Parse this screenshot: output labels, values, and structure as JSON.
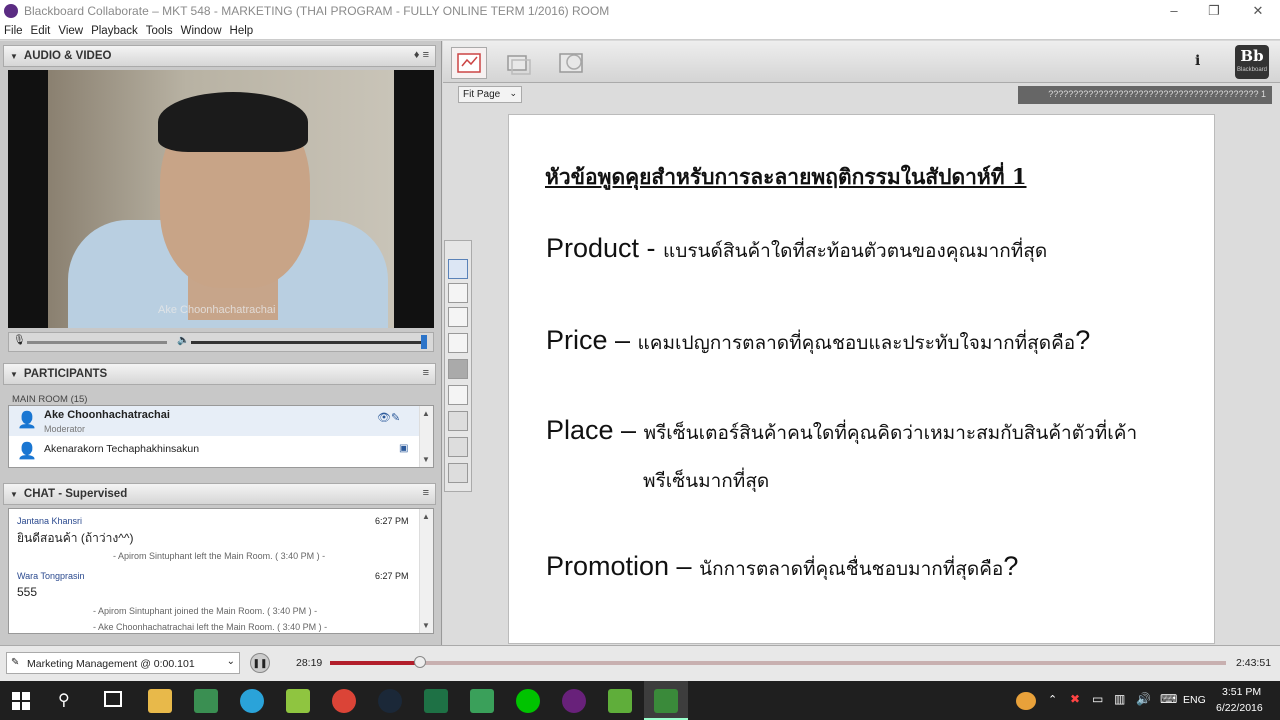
{
  "window": {
    "title": "Blackboard Collaborate – MKT 548 - MARKETING (THAI PROGRAM - FULLY ONLINE TERM 1/2016) ROOM"
  },
  "menu": [
    "File",
    "Edit",
    "View",
    "Playback",
    "Tools",
    "Window",
    "Help"
  ],
  "av_panel": {
    "title": "AUDIO & VIDEO",
    "speaker_name": "Ake Choonhachatrachai"
  },
  "participants": {
    "title": "PARTICIPANTS",
    "room": "MAIN ROOM (15)",
    "items": [
      {
        "name": "Ake Choonhachatrachai",
        "role": "Moderator"
      },
      {
        "name": "Akenarakorn Techaphakhinsakun",
        "role": ""
      }
    ]
  },
  "chat": {
    "title": "CHAT - Supervised",
    "messages": [
      {
        "type": "msg",
        "sender": "Jantana Khansri",
        "time": "6:27 PM",
        "text": "ยินดีสอนค้า (ถ้าว่าง^^)"
      },
      {
        "type": "sys",
        "text": "- Apirom Sintuphant left the Main Room. ( 3:40 PM ) -"
      },
      {
        "type": "msg",
        "sender": "Wara Tongprasin",
        "time": "6:27 PM",
        "text": "555"
      },
      {
        "type": "sys",
        "text": "- Apirom Sintuphant joined the Main Room. ( 3:40 PM ) -"
      },
      {
        "type": "sys",
        "text": "- Ake Choonhachatrachai left the Main Room. ( 3:40 PM ) -"
      }
    ]
  },
  "whiteboard": {
    "fit_label": "Fit Page",
    "page_label": "?????????????????????????????????????????? 1",
    "info_label": "i",
    "brand_short": "Bb",
    "brand_name": "Blackboard"
  },
  "slide": {
    "heading": "หัวข้อพูดคุยสำหรับการละลายพฤติกรรมในสัปดาห์ที่ 1",
    "rows": [
      {
        "key": "Product - ",
        "desc": "แบรนด์สินค้าใดที่สะท้อนตัวตนของคุณมากที่สุด"
      },
      {
        "key": "Price – ",
        "desc": "แคมเปญการตลาดที่คุณชอบและประทับใจมากที่สุดคือ",
        "tail": "?"
      },
      {
        "key": "Place – ",
        "desc": "พรีเซ็นเตอร์สินค้าคนใดที่คุณคิดว่าเหมาะสมกับสินค้าตัวที่เค้า",
        "desc2": "พรีเซ็นมากที่สุด"
      },
      {
        "key": "Promotion – ",
        "desc": "นักการตลาดที่คุณชื่นชอบมากที่สุดคือ",
        "tail": "?"
      }
    ]
  },
  "playback": {
    "recording": "Marketing Management @ 0:00.101",
    "elapsed": "28:19",
    "total": "2:43:51",
    "progress": 0.1,
    "accent": "#b21e2b"
  },
  "taskbar": {
    "lang": "ENG",
    "time": "3:51 PM",
    "date": "6/22/2016"
  }
}
